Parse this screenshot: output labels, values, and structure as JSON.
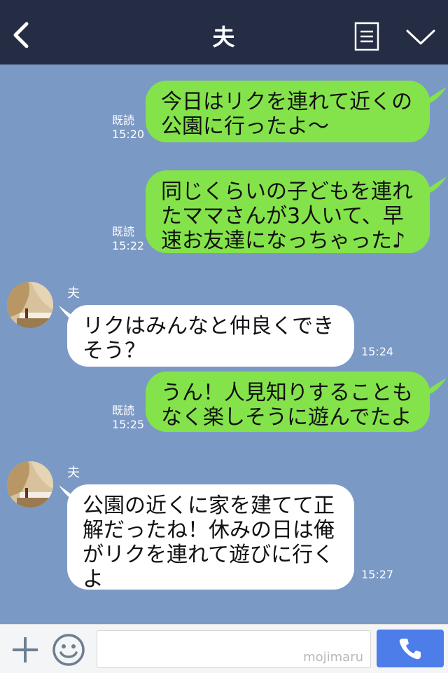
{
  "header": {
    "title": "夫",
    "icons": {
      "back": "chevron-left-icon",
      "menu": "menu-list-icon",
      "dropdown": "chevron-down-icon"
    }
  },
  "colors": {
    "header_bg": "#242d43",
    "chat_bg": "#7b99c5",
    "outgoing_bubble": "#84e34a",
    "incoming_bubble": "#ffffff",
    "send_button": "#4c7de9"
  },
  "messages": [
    {
      "direction": "out",
      "text": "今日はリクを連れて近くの\n公園に行ったよ〜",
      "read": "既読",
      "time": "15:20"
    },
    {
      "direction": "out",
      "text": "同じくらいの子どもを連れ\nたママさんが3人いて、早\n速お友達になっちゃった♪",
      "read": "既読",
      "time": "15:22"
    },
    {
      "direction": "in",
      "sender": "夫",
      "text": "リクはみんなと仲良くでき\nそう？",
      "time": "15:24"
    },
    {
      "direction": "out",
      "text": "うん！人見知りすることも\nなく楽しそうに遊んでたよ",
      "read": "既読",
      "time": "15:25"
    },
    {
      "direction": "in",
      "sender": "夫",
      "text": "公園の近くに家を建てて正\n解だったね！休みの日は俺\nがリクを連れて遊びに行く\nよ",
      "time": "15:27"
    }
  ],
  "input_bar": {
    "plus_icon": "plus-icon",
    "emoji_icon": "smile-icon",
    "input_value": "",
    "watermark": "mojimaru",
    "call_icon": "phone-icon"
  }
}
